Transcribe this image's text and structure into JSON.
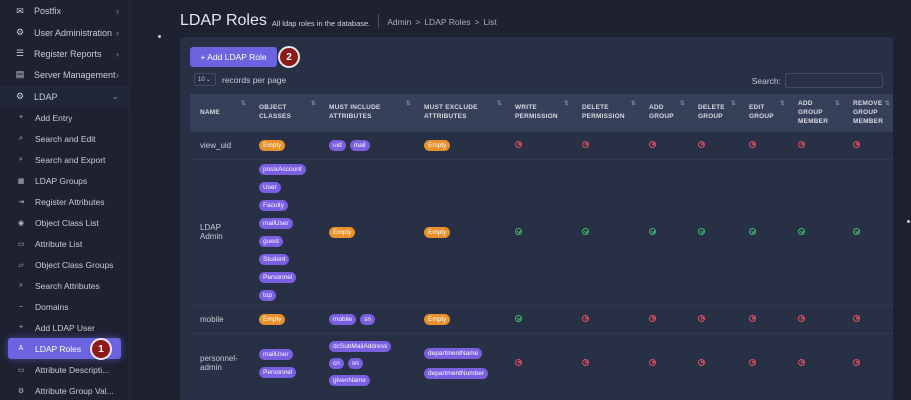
{
  "sidebar": {
    "top_items": [
      {
        "label": "Postfix",
        "icon": "mail-icon"
      },
      {
        "label": "User Administration",
        "icon": "gear-icon"
      },
      {
        "label": "Register Reports",
        "icon": "list-icon"
      },
      {
        "label": "Server Management",
        "icon": "server-icon"
      },
      {
        "label": "LDAP",
        "icon": "gear-icon"
      }
    ],
    "ldap_items": [
      {
        "label": "Add Entry"
      },
      {
        "label": "Search and Edit"
      },
      {
        "label": "Search and Export"
      },
      {
        "label": "LDAP Groups"
      },
      {
        "label": "Register Attributes"
      },
      {
        "label": "Object Class List"
      },
      {
        "label": "Attribute List"
      },
      {
        "label": "Object Class Groups"
      },
      {
        "label": "Search Attributes"
      },
      {
        "label": "Domains"
      },
      {
        "label": "Add LDAP User"
      },
      {
        "label": "LDAP Roles"
      },
      {
        "label": "Attribute Descripti..."
      },
      {
        "label": "Attribute Group Val..."
      }
    ]
  },
  "markers": {
    "one": "1",
    "two": "2"
  },
  "header": {
    "title": "LDAP Roles",
    "subtitle": "All ldap roles in the database.",
    "breadcrumbs": [
      "Admin",
      ">",
      "LDAP Roles",
      ">",
      "List"
    ]
  },
  "toolbar": {
    "add_label": "+ Add LDAP Role",
    "length_value": "10",
    "length_label": "records per page",
    "search_label": "Search:"
  },
  "table": {
    "columns": [
      "NAME",
      "OBJECT CLASSES",
      "MUST INCLUDE ATTRIBUTES",
      "MUST EXCLUDE ATTRIBUTES",
      "WRITE PERMISSION",
      "DELETE PERMISSION",
      "ADD GROUP",
      "DELETE GROUP",
      "EDIT GROUP",
      "ADD GROUP MEMBER",
      "REMOVE GROUP MEMBER"
    ],
    "rows": [
      {
        "name": "view_uid",
        "object_classes": [
          "Empty"
        ],
        "must_include": [
          "uid",
          "mail"
        ],
        "must_exclude": [
          "Empty"
        ],
        "perms": [
          false,
          false,
          false,
          false,
          false,
          false,
          false
        ]
      },
      {
        "name": "LDAP Admin",
        "object_classes": [
          "posixAccount",
          "User",
          "Faculty",
          "mailUser",
          "guest",
          "Student",
          "Personnel",
          "top"
        ],
        "must_include": [
          "Empty"
        ],
        "must_exclude": [
          "Empty"
        ],
        "perms": [
          true,
          true,
          true,
          true,
          true,
          true,
          true
        ]
      },
      {
        "name": "mobile",
        "object_classes": [
          "Empty"
        ],
        "must_include": [
          "mobile",
          "sn"
        ],
        "must_exclude": [
          "Empty"
        ],
        "perms": [
          true,
          false,
          false,
          false,
          false,
          false,
          false
        ]
      },
      {
        "name": "personnel-admin",
        "object_classes": [
          "mailUser",
          "Personnel"
        ],
        "must_include_rows": [
          [
            "dcSubMailAddress"
          ],
          [
            "cn",
            "sn"
          ],
          [
            "givenName"
          ]
        ],
        "must_exclude": [
          "departmentName",
          "departmentNumber"
        ],
        "perms": [
          false,
          false,
          false,
          false,
          false,
          false,
          false
        ]
      }
    ]
  },
  "colors": {
    "accent": "#6c63e0",
    "empty_tag": "#e8912c",
    "tag": "#7a5fe0",
    "ok": "#3fbf6f",
    "no": "#e05060"
  }
}
